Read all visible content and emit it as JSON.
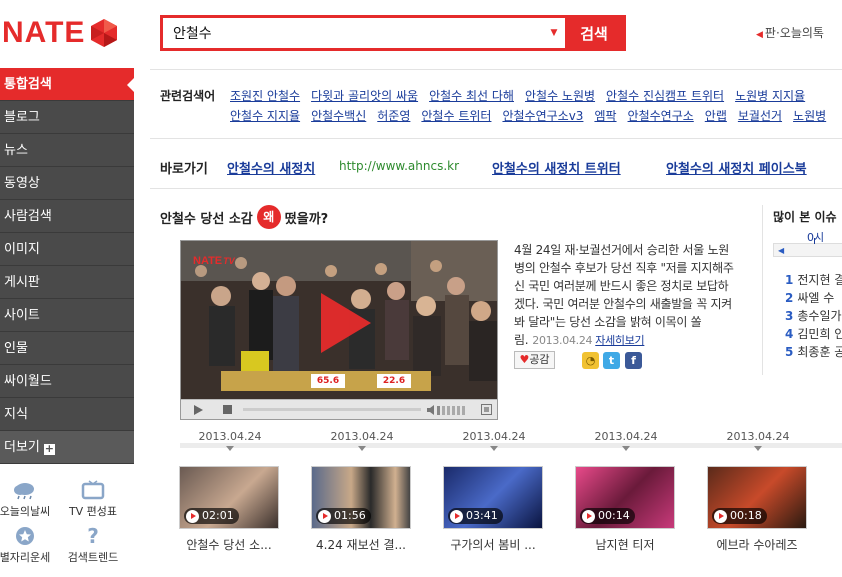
{
  "logo": "NATE",
  "search": {
    "query": "안철수",
    "button": "검색"
  },
  "header_link": "판·오늘의톡",
  "sidebar": {
    "items": [
      {
        "label": "통합검색"
      },
      {
        "label": "블로그"
      },
      {
        "label": "뉴스"
      },
      {
        "label": "동영상"
      },
      {
        "label": "사람검색"
      },
      {
        "label": "이미지"
      },
      {
        "label": "게시판"
      },
      {
        "label": "사이트"
      },
      {
        "label": "인물"
      },
      {
        "label": "싸이월드"
      },
      {
        "label": "지식"
      }
    ],
    "more": "더보기"
  },
  "tools": [
    {
      "label": "오늘의날씨",
      "icon": "weather-icon"
    },
    {
      "label": "TV 편성표",
      "icon": "tv-icon"
    },
    {
      "label": "별자리운세",
      "icon": "star-icon"
    },
    {
      "label": "검색트렌드",
      "icon": "question-icon"
    }
  ],
  "related": {
    "label": "관련검색어",
    "row1": [
      "조원진 안철수",
      "다윗과 골리앗의 싸움",
      "안철수 최선 다해",
      "안철수 노원병",
      "안철수 진심캠프 트위터",
      "노원병 지지율"
    ],
    "row2": [
      "안철수 지지율",
      "안철수백신",
      "허준영",
      "안철수 트위터",
      "안철수연구소v3",
      "엠팍",
      "안철수연구소",
      "안랩",
      "보궐선거",
      "노원병"
    ]
  },
  "shortcuts": {
    "label": "바로가기",
    "site": "안철수의 새정치",
    "url": "http://www.ahncs.kr",
    "twitter": "안철수의 새정치 트위터",
    "facebook": "안철수의 새정치 페이스북"
  },
  "article": {
    "title_before": "안철수 당선 소감",
    "title_badge": "왜",
    "title_after": "떴을까?",
    "video_logo": "NATE",
    "video_logo_tv": "TV",
    "text": "4월 24일 재·보궐선거에서 승리한 서울 노원병의 안철수 후보가 당선 직후 \"저를 지지해주신 국민 여러분께 반드시 좋은 정치로 보답하겠다. 국민 여러분 안철수의 새출발을 꼭 지켜봐 달라\"는 당선 소감을 밝혀 이목이 쏠림.",
    "date": "2013.04.24",
    "more": "자세히보기",
    "like": "공감",
    "tally": [
      "65.6",
      "22.6"
    ]
  },
  "popular": {
    "title": "많이 본 이슈",
    "time": "0시",
    "items": [
      {
        "rank": "1",
        "label": "전지현 결"
      },
      {
        "rank": "2",
        "label": "싸엘 수"
      },
      {
        "rank": "3",
        "label": "총수일가"
      },
      {
        "rank": "4",
        "label": "김민희 인"
      },
      {
        "rank": "5",
        "label": "최종훈 공"
      }
    ]
  },
  "timeline": {
    "dates": [
      "2013.04.24",
      "2013.04.24",
      "2013.04.24",
      "2013.04.24",
      "2013.04.24"
    ]
  },
  "videos": [
    {
      "duration": "02:01",
      "title": "안철수 당선 소..."
    },
    {
      "duration": "01:56",
      "title": "4.24 재보선 결..."
    },
    {
      "duration": "03:41",
      "title": "구가의서 봄비 ..."
    },
    {
      "duration": "00:14",
      "title": "남지현 티저"
    },
    {
      "duration": "00:18",
      "title": "에브라 수아레즈"
    }
  ],
  "colors": {
    "brand": "#e52b2b",
    "link": "#1a3c9a",
    "url": "#2e8b2e",
    "sidebar": "#4a4a4a"
  }
}
